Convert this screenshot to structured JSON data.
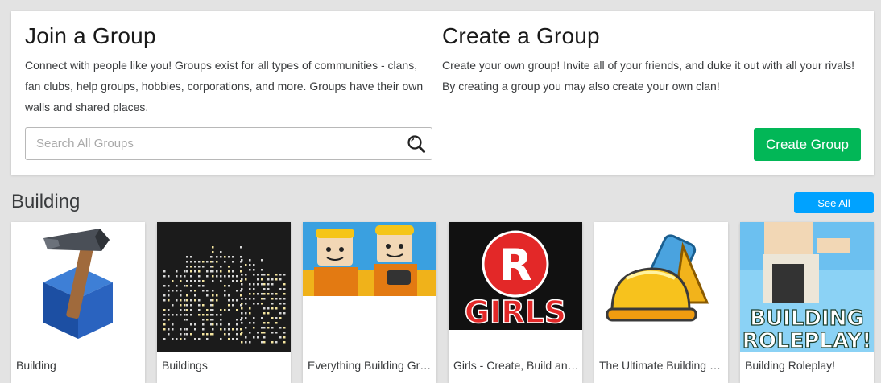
{
  "join": {
    "title": "Join a Group",
    "description": "Connect with people like you! Groups exist for all types of communities - clans, fan clubs, help groups, hobbies, corporations, and more. Groups have their own walls and shared places.",
    "search_placeholder": "Search All Groups",
    "search_icon": "magnifier-icon"
  },
  "create": {
    "title": "Create a Group",
    "description": "Create your own group! Invite all of your friends, and duke it out with all your rivals! By creating a group you may also create your own clan!",
    "button_label": "Create Group",
    "button_color": "#02b757"
  },
  "section": {
    "title": "Building",
    "see_all_label": "See All",
    "see_all_color": "#00a2ff"
  },
  "groups": [
    {
      "name": "Building"
    },
    {
      "name": "Buildings"
    },
    {
      "name": "Everything Building Group"
    },
    {
      "name": "Girls - Create, Build and Share"
    },
    {
      "name": "The Ultimate Building Group"
    },
    {
      "name": "Building Roleplay!"
    }
  ],
  "thumbnail_text": {
    "girls_r": "R",
    "girls_word": "GIRLS",
    "roleplay_line1": "BUILDING",
    "roleplay_line2": "ROLEPLAY!"
  }
}
